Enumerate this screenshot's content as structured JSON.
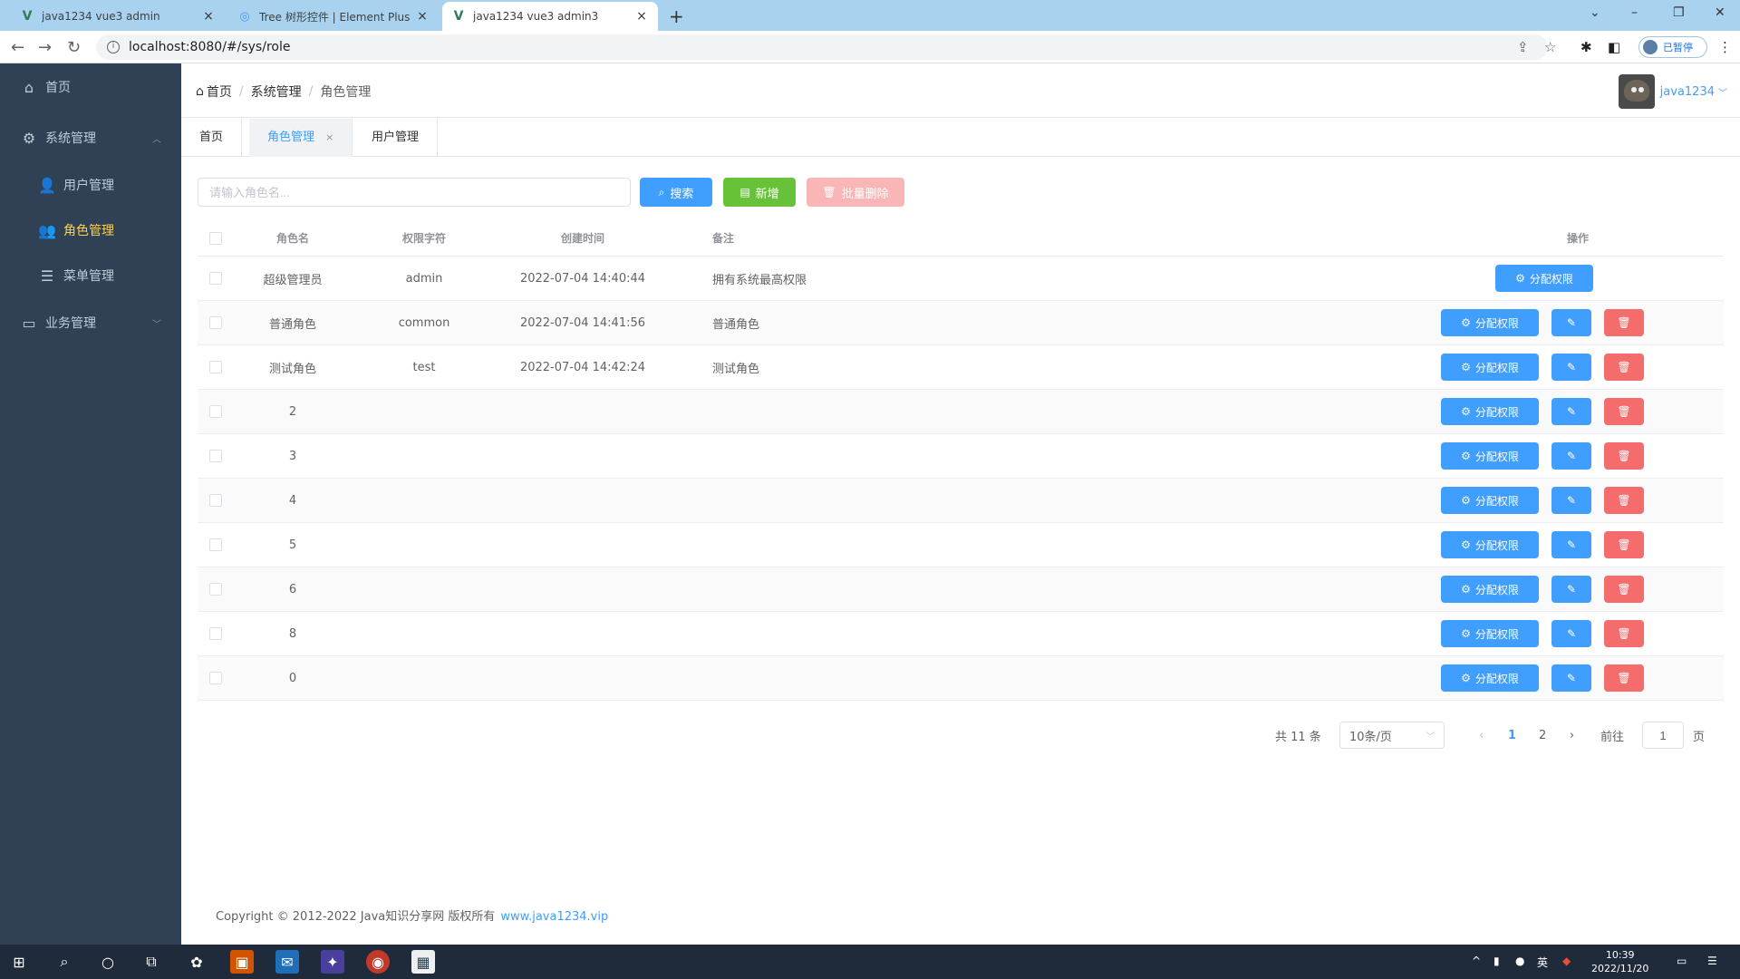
{
  "browser": {
    "tabs": [
      {
        "title": "java1234 vue3 admin",
        "icon": "v-icon"
      },
      {
        "title": "Tree 树形控件 | Element Plus",
        "icon": "tree-icon"
      },
      {
        "title": "java1234 vue3 admin3",
        "icon": "v-icon"
      }
    ],
    "new_tab": "+",
    "url": "localhost:8080/#/sys/role",
    "profile_label": "已暂停"
  },
  "sidebar": {
    "items": [
      {
        "label": "首页",
        "icon": "home-icon"
      },
      {
        "label": "系统管理",
        "icon": "gear-icon"
      },
      {
        "label": "用户管理",
        "icon": "user-icon"
      },
      {
        "label": "角色管理",
        "icon": "role-icon"
      },
      {
        "label": "菜单管理",
        "icon": "tree-list-icon"
      },
      {
        "label": "业务管理",
        "icon": "monitor-icon"
      }
    ]
  },
  "header": {
    "breadcrumb": [
      "首页",
      "系统管理",
      "角色管理"
    ],
    "username": "java1234"
  },
  "page_tabs": [
    {
      "label": "首页"
    },
    {
      "label": "角色管理",
      "close": "×"
    },
    {
      "label": "用户管理"
    }
  ],
  "search": {
    "placeholder": "请输入角色名...",
    "search_label": "搜索",
    "add_label": "新增",
    "batch_delete_label": "批量删除"
  },
  "table": {
    "columns": [
      "角色名",
      "权限字符",
      "创建时间",
      "备注",
      "操作"
    ],
    "rows": [
      {
        "name": "超级管理员",
        "code": "admin",
        "created": "2022-07-04 14:40:44",
        "remark": "拥有系统最高权限"
      },
      {
        "name": "普通角色",
        "code": "common",
        "created": "2022-07-04 14:41:56",
        "remark": "普通角色"
      },
      {
        "name": "测试角色",
        "code": "test",
        "created": "2022-07-04 14:42:24",
        "remark": "测试角色"
      },
      {
        "name": "2",
        "code": "",
        "created": "",
        "remark": ""
      },
      {
        "name": "3",
        "code": "",
        "created": "",
        "remark": ""
      },
      {
        "name": "4",
        "code": "",
        "created": "",
        "remark": ""
      },
      {
        "name": "5",
        "code": "",
        "created": "",
        "remark": ""
      },
      {
        "name": "6",
        "code": "",
        "created": "",
        "remark": ""
      },
      {
        "name": "8",
        "code": "",
        "created": "",
        "remark": ""
      },
      {
        "name": "0",
        "code": "",
        "created": "",
        "remark": ""
      }
    ],
    "assign_label": "分配权限"
  },
  "pagination": {
    "total_text": "共 11 条",
    "page_size": "10条/页",
    "pages": [
      "1",
      "2"
    ],
    "goto_label": "前往",
    "goto_value": "1",
    "page_unit": "页",
    "prev": "‹",
    "next": "›"
  },
  "footer": {
    "copyright": "Copyright © 2012-2022 Java知识分享网 版权所有",
    "link": "www.java1234.vip"
  },
  "taskbar": {
    "clock_time": "10:39",
    "clock_date": "2022/11/20",
    "lang": "英"
  },
  "colors": {
    "sidebar_bg": "#304156",
    "sidebar_text": "#bfcbd9",
    "active_text": "#ffd04b",
    "primary": "#409eff",
    "success": "#67c23a",
    "danger": "#f56c6c"
  }
}
